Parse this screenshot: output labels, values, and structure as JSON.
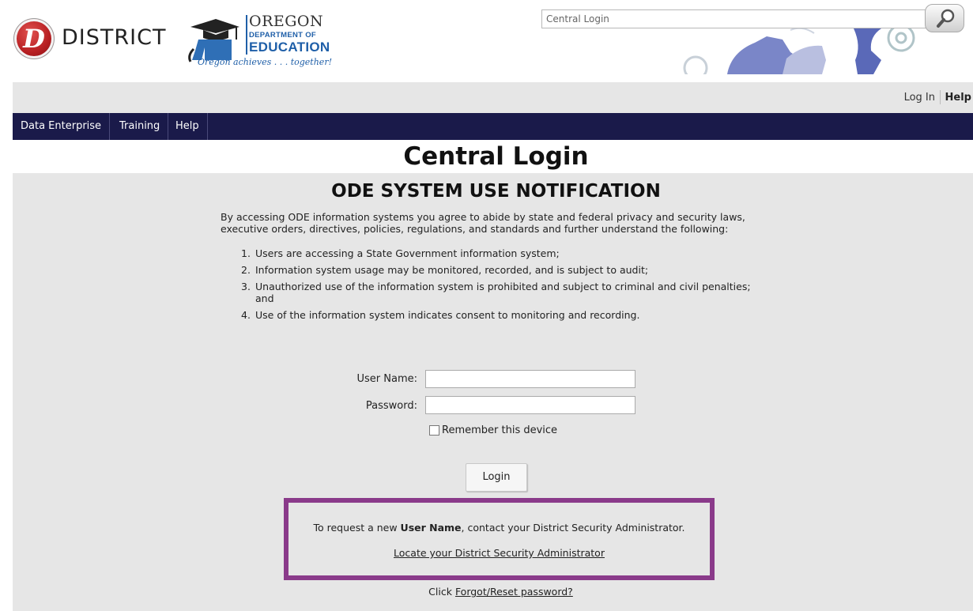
{
  "header": {
    "logo_letter": "D",
    "logo_text": "DISTRICT",
    "ode_oregon": "OREGON",
    "ode_dept": "DEPARTMENT OF",
    "ode_education": "EDUCATION",
    "ode_tagline": "Oregon achieves . . . together!",
    "search_value": "Central Login",
    "search_icon": "magnifier-icon"
  },
  "util": {
    "login": "Log In",
    "help": "Help"
  },
  "nav": {
    "items": [
      "Data Enterprise",
      "Training",
      "Help"
    ]
  },
  "page": {
    "title": "Central Login"
  },
  "notice": {
    "title": "ODE SYSTEM USE NOTIFICATION",
    "intro_line1": "By accessing ODE information systems you agree to abide by state and federal privacy and security laws,",
    "intro_line2": "executive orders, directives, policies, regulations, and standards and further understand the following:",
    "items": [
      {
        "num": "1.",
        "text": "Users are accessing a State Government information system;"
      },
      {
        "num": "2.",
        "text": "Information system usage may be monitored, recorded, and is subject to audit;"
      },
      {
        "num": "3.",
        "text": "Unauthorized use of the information system is prohibited and subject to criminal and civil penalties;",
        "text2": "and"
      },
      {
        "num": "4.",
        "text": "Use of the information system indicates consent to monitoring and recording."
      }
    ]
  },
  "form": {
    "username_label": "User Name:",
    "username_value": "",
    "password_label": "Password:",
    "password_value": "",
    "remember_label": "Remember this device",
    "login_button": "Login"
  },
  "request": {
    "prefix": "To request a new ",
    "bold": "User Name",
    "suffix": ", contact your District Security Administrator.",
    "locate_link": "Locate your District Security Administrator"
  },
  "forgot": {
    "prefix": "Click ",
    "link": "Forgot/Reset password?"
  },
  "colors": {
    "nav_bg": "#1a1a4a",
    "highlight_border": "#8a3a8a",
    "panel_bg": "#e6e6e6",
    "ode_blue": "#1f5fa8"
  }
}
